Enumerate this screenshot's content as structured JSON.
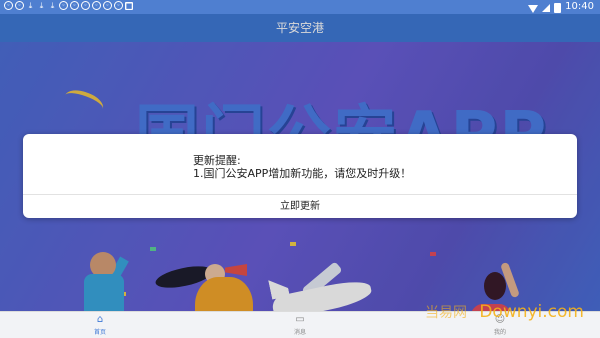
{
  "status_bar": {
    "notification_icons": [
      "ring-icon",
      "ring-icon",
      "download-icon",
      "download-icon",
      "download-icon",
      "ring-icon",
      "ring-icon",
      "ring-icon",
      "ring-icon",
      "ring-icon",
      "ring-icon",
      "box-icon"
    ],
    "time": "10:40"
  },
  "app_bar": {
    "title": "平安空港"
  },
  "banner": {
    "title": "国门公安APP",
    "watermark": "Downyi.com",
    "watermark_cn": "当易网"
  },
  "dialog": {
    "title": "更新提醒:",
    "message": "1.国门公安APP增加新功能，请您及时升级！",
    "button": "立即更新"
  },
  "bottom_nav": {
    "items": [
      {
        "label": "首页",
        "icon": "home-icon",
        "active": true
      },
      {
        "label": "消息",
        "icon": "message-icon",
        "active": false
      },
      {
        "label": "我的",
        "icon": "user-icon",
        "active": false
      }
    ]
  },
  "colors": {
    "primary": "#3f79d6",
    "watermark": "#f5b21a"
  }
}
